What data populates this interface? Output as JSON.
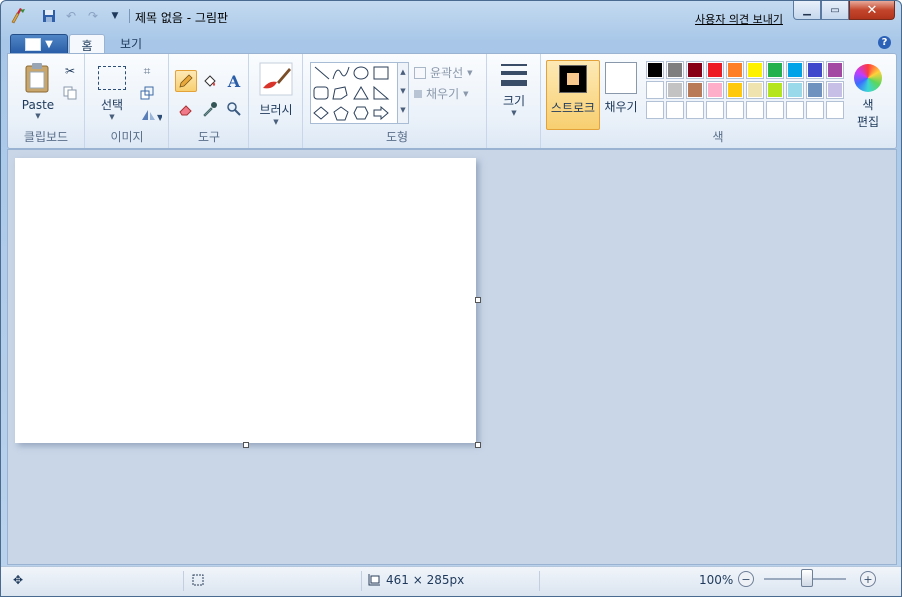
{
  "window": {
    "title": "제목 없음 - 그림판",
    "feedback_link": "사용자 의견 보내기"
  },
  "tabs": [
    "홈",
    "보기"
  ],
  "ribbon": {
    "clipboard": {
      "paste": "Paste",
      "label": "클립보드"
    },
    "image": {
      "select": "선택",
      "label": "이미지"
    },
    "tools": {
      "label": "도구"
    },
    "brushes": {
      "label": "브러시"
    },
    "shapes": {
      "outline": "윤곽선",
      "fill": "채우기",
      "label": "도형"
    },
    "size": {
      "label": "크기"
    },
    "colors": {
      "stroke": "스트로크",
      "fill": "채우기",
      "edit": "색\n편집",
      "edit_line1": "색",
      "edit_line2": "편집",
      "label": "색",
      "stroke_color": "#000000",
      "fill_color": "#ffffff",
      "palette_row1": [
        "#000000",
        "#7f7f7f",
        "#880015",
        "#ed1c24",
        "#ff7f27",
        "#fff200",
        "#22b14c",
        "#00a2e8",
        "#3f48cc",
        "#a349a4"
      ],
      "palette_row2": [
        "#ffffff",
        "#c3c3c3",
        "#b97a57",
        "#ffaec9",
        "#ffc90e",
        "#efe4b0",
        "#b5e61d",
        "#99d9ea",
        "#7092be",
        "#c8bfe7"
      ],
      "palette_row3": [
        "#ffffff",
        "#ffffff",
        "#ffffff",
        "#ffffff",
        "#ffffff",
        "#ffffff",
        "#ffffff",
        "#ffffff",
        "#ffffff",
        "#ffffff"
      ]
    }
  },
  "status": {
    "canvas_size": "461 × 285px",
    "zoom": "100%"
  }
}
